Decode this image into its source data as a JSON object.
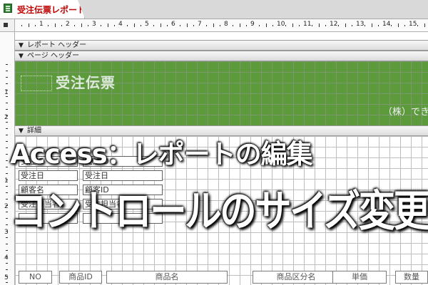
{
  "document_tab": {
    "label": "受注伝票レポート"
  },
  "ruler": {
    "horizontal_numbers": [
      "1",
      "2",
      "3",
      "4",
      "5",
      "6",
      "7",
      "8",
      "9",
      "10",
      "11",
      "12",
      "13",
      "14",
      "15",
      "16"
    ],
    "vertical_numbers": [
      "1",
      "2",
      "1",
      "2",
      "3",
      "4",
      "5"
    ]
  },
  "sections": {
    "report_header": "レポート ヘッダー",
    "page_header": "ページ ヘッダー",
    "detail": "詳細"
  },
  "page_header": {
    "title": "受注伝票",
    "company": "（株）でき",
    "band_color": "#5c9a3c"
  },
  "detail_controls": [
    {
      "label": "受注ID",
      "value": "受注ID"
    },
    {
      "label": "受注日",
      "value": "受注日"
    },
    {
      "label": "顧客名",
      "value": "顧客ID"
    },
    {
      "label": "受注担当者",
      "value": "受注担当者"
    }
  ],
  "table_header": [
    "NO",
    "商品ID",
    "商品名",
    "商品区分名",
    "単価",
    "数量"
  ],
  "overlay": {
    "line1": "Access：レポートの編集",
    "line2": "コントロールのサイズ変更"
  }
}
